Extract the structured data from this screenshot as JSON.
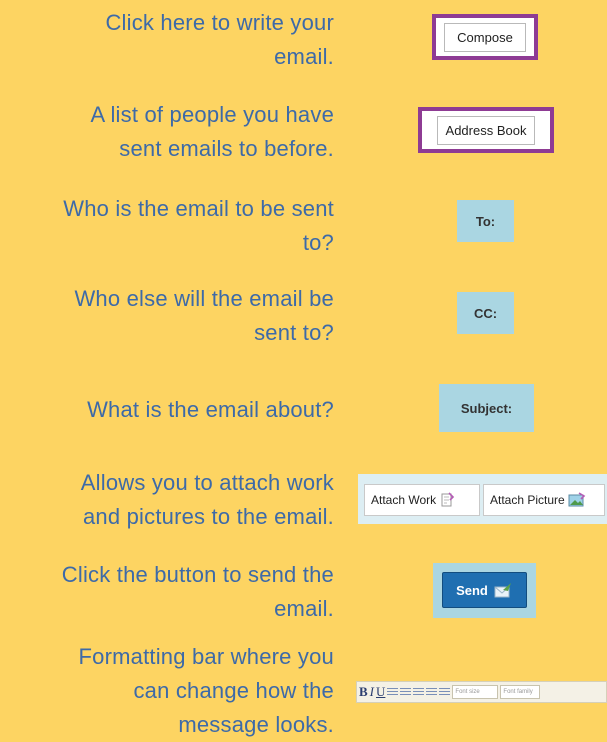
{
  "rows": [
    {
      "desc": [
        "Click here to write your",
        "email."
      ],
      "control": "Compose"
    },
    {
      "desc": [
        "A list of people you have",
        "sent emails to before."
      ],
      "control": "Address Book"
    },
    {
      "desc": [
        "Who is the email to be sent",
        "to?"
      ],
      "control": "To:"
    },
    {
      "desc": [
        "Who else will the email be",
        "sent to?"
      ],
      "control": "CC:"
    },
    {
      "desc": [
        "What is the email about?"
      ],
      "control": "Subject:"
    },
    {
      "desc": [
        "Allows you to attach work",
        "and pictures to the email."
      ],
      "controls": [
        "Attach Work",
        "Attach Picture"
      ]
    },
    {
      "desc": [
        "Click the button to send the",
        "email."
      ],
      "control": "Send"
    },
    {
      "desc": [
        "Formatting bar where you",
        "can change how the",
        "message looks."
      ],
      "toolbar": {
        "bold": "B",
        "italic": "I",
        "underline": "U",
        "font_size": "Font size",
        "font_family": "Font family"
      }
    }
  ],
  "colors": {
    "background": "#fdd462",
    "text": "#3d6aa8",
    "highlight": "#8e3b94",
    "field": "#aad6e2",
    "send": "#1f6fb1"
  },
  "icons": [
    "attach-work-icon",
    "attach-picture-icon",
    "send-icon",
    "align-left-icon",
    "align-center-icon",
    "align-right-icon",
    "justify-icon",
    "list-icon"
  ]
}
